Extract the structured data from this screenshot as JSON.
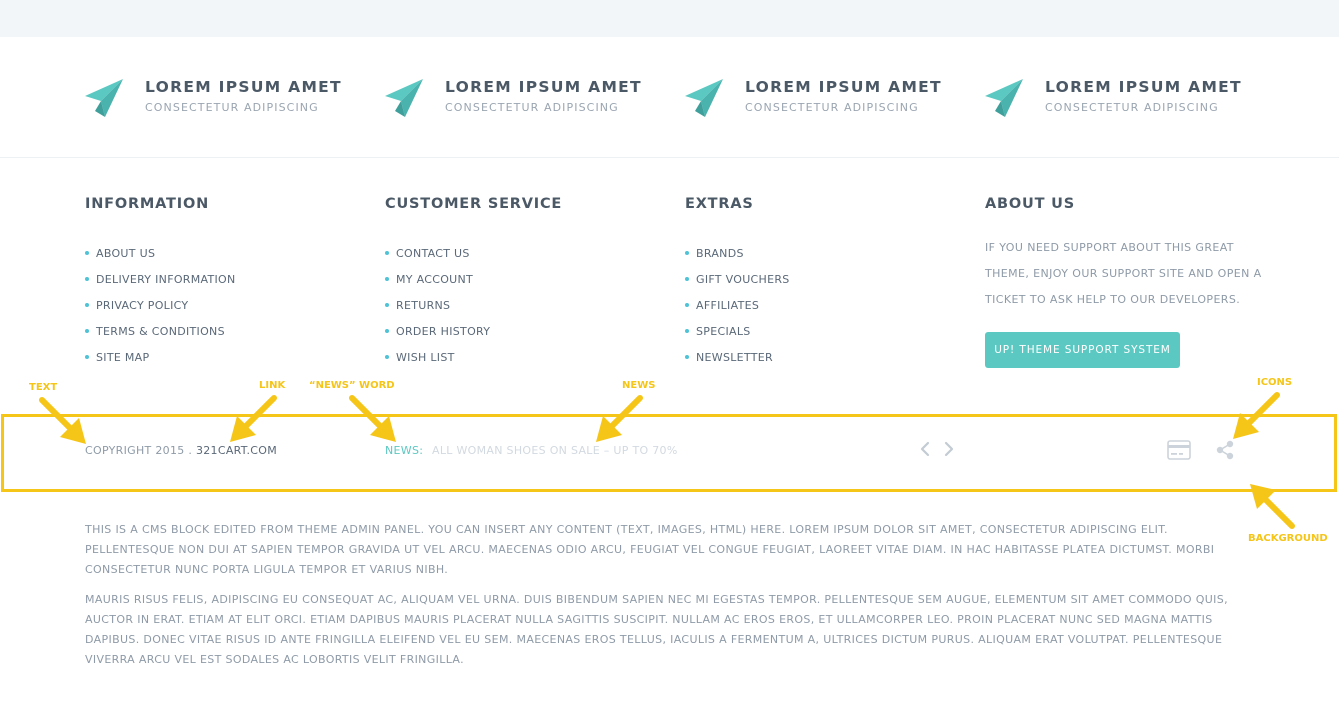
{
  "features": [
    {
      "title": "LOREM IPSUM AMET",
      "subtitle": "CONSECTETUR ADIPISCING"
    },
    {
      "title": "LOREM IPSUM AMET",
      "subtitle": "CONSECTETUR ADIPISCING"
    },
    {
      "title": "LOREM IPSUM AMET",
      "subtitle": "CONSECTETUR ADIPISCING"
    },
    {
      "title": "LOREM IPSUM AMET",
      "subtitle": "CONSECTETUR ADIPISCING"
    }
  ],
  "columns": {
    "information": {
      "title": "INFORMATION",
      "items": [
        "ABOUT US",
        "DELIVERY INFORMATION",
        "PRIVACY POLICY",
        "TERMS & CONDITIONS",
        "SITE MAP"
      ]
    },
    "customer_service": {
      "title": "CUSTOMER SERVICE",
      "items": [
        "CONTACT US",
        "MY ACCOUNT",
        "RETURNS",
        "ORDER HISTORY",
        "WISH LIST"
      ]
    },
    "extras": {
      "title": "EXTRAS",
      "items": [
        "BRANDS",
        "GIFT VOUCHERS",
        "AFFILIATES",
        "SPECIALS",
        "NEWSLETTER"
      ]
    },
    "about": {
      "title": "ABOUT US",
      "text": "IF YOU NEED SUPPORT ABOUT THIS GREAT THEME, ENJOY OUR SUPPORT SITE AND OPEN A TICKET TO ASK HELP TO OUR DEVELOPERS.",
      "button": "UP! THEME SUPPORT SYSTEM"
    }
  },
  "annotations": {
    "text": "TEXT",
    "link": "LINK",
    "news_word": "“NEWS” WORD",
    "news": "NEWS",
    "icons": "ICONS",
    "background": "BACKGROUND"
  },
  "bottom_bar": {
    "copyright": "COPYRIGHT 2015 . ",
    "link": "321CART.COM",
    "news_label": "NEWS:",
    "news_item": "ALL WOMAN SHOES ON SALE – UP TO 70%",
    "icons": [
      "chevron-left-icon",
      "chevron-right-icon",
      "credit-card-icon",
      "share-icon"
    ]
  },
  "cms_block": {
    "paragraph1": "THIS IS A CMS BLOCK EDITED FROM THEME ADMIN PANEL. YOU CAN INSERT ANY CONTENT (TEXT, IMAGES, HTML) HERE. LOREM IPSUM DOLOR SIT AMET, CONSECTETUR ADIPISCING ELIT. PELLENTESQUE NON DUI AT SAPIEN TEMPOR GRAVIDA UT VEL ARCU. MAECENAS ODIO ARCU, FEUGIAT VEL CONGUE FEUGIAT, LAOREET VITAE DIAM. IN HAC HABITASSE PLATEA DICTUMST. MORBI CONSECTETUR NUNC PORTA LIGULA TEMPOR ET VARIUS NIBH.",
    "paragraph2": "MAURIS RISUS FELIS, ADIPISCING EU CONSEQUAT AC, ALIQUAM VEL URNA. DUIS BIBENDUM SAPIEN NEC MI EGESTAS TEMPOR. PELLENTESQUE SEM AUGUE, ELEMENTUM SIT AMET COMMODO QUIS, AUCTOR IN ERAT. ETIAM AT ELIT ORCI. ETIAM DAPIBUS MAURIS PLACERAT NULLA SAGITTIS SUSCIPIT. NULLAM AC EROS EROS, ET ULLAMCORPER LEO. PROIN PLACERAT NUNC SED MAGNA MATTIS DAPIBUS. DONEC VITAE RISUS ID ANTE FRINGILLA ELEIFEND VEL EU SEM. MAECENAS EROS TELLUS, IACULIS A FERMENTUM A, ULTRICES DICTUM PURUS. ALIQUAM ERAT VOLUTPAT. PELLENTESQUE VIVERRA ARCU VEL EST SODALES AC LOBORTIS VELIT FRINGILLA."
  },
  "colors": {
    "accent": "#5cc8c2",
    "bullet": "#4fc3d6",
    "annotation": "#f5c518",
    "heading": "#4b5866",
    "muted": "#8e9aa7"
  }
}
